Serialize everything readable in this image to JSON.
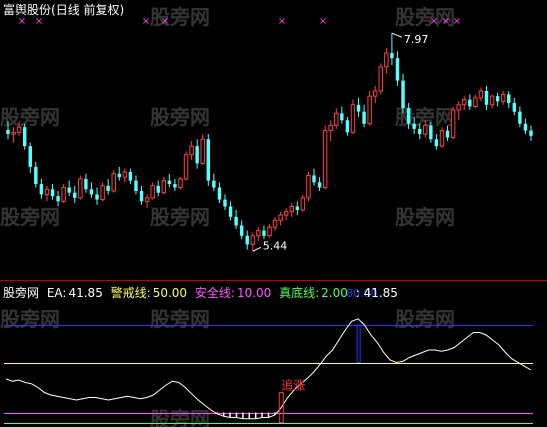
{
  "colors": {
    "background": "#000000",
    "up_candle": "#ff4040",
    "down_candle": "#54ffff",
    "top_marker": "#ff40ff",
    "panel_divider": "#c00000",
    "indicator_line": "#ffffff",
    "warning_line": "#ffff54",
    "safety_line": "#ff54ff",
    "bottom_line": "#54ff54",
    "upper_line": "#3030ff",
    "signal": "#ff3030"
  },
  "header": {
    "stock_name": "富舆股份",
    "chart_mode": "(日线 前复权)"
  },
  "price_panel": {
    "high_label": "7.97",
    "low_label": "5.44",
    "markers": [
      "×",
      "×",
      "×",
      "×",
      "×",
      "×",
      "×",
      "×",
      "×"
    ]
  },
  "indicator": {
    "name": "股旁网",
    "ea_label": "EA:",
    "ea_value": "41.85",
    "warning_label": "警戒线:",
    "warning_value": "50.00",
    "safety_label": "安全线:",
    "safety_value": "10.00",
    "bottom_label": "真底线:",
    "bottom_value": "2.00",
    "extra_value": ": 41.85",
    "upper_value": "80.00",
    "signal_label": "追涨"
  },
  "watermarks": [
    "股旁网",
    "股旁网",
    "股旁网",
    "股旁网",
    "股旁网",
    "股旁网",
    "股旁网",
    "股旁网",
    "股旁网",
    "股旁网",
    "股旁网",
    "股旁网"
  ],
  "chart_data": [
    {
      "type": "candlestick",
      "title": "",
      "ylim": [
        5.2,
        8.1
      ],
      "candles": [
        {
          "o": 6.85,
          "h": 6.95,
          "l": 6.74,
          "c": 6.8
        },
        {
          "o": 6.8,
          "h": 6.88,
          "l": 6.7,
          "c": 6.82
        },
        {
          "o": 6.82,
          "h": 6.95,
          "l": 6.78,
          "c": 6.88
        },
        {
          "o": 6.88,
          "h": 6.92,
          "l": 6.62,
          "c": 6.66
        },
        {
          "o": 6.66,
          "h": 6.7,
          "l": 6.35,
          "c": 6.42
        },
        {
          "o": 6.42,
          "h": 6.48,
          "l": 6.18,
          "c": 6.22
        },
        {
          "o": 6.22,
          "h": 6.28,
          "l": 6.05,
          "c": 6.1
        },
        {
          "o": 6.1,
          "h": 6.2,
          "l": 6.02,
          "c": 6.16
        },
        {
          "o": 6.16,
          "h": 6.22,
          "l": 6.04,
          "c": 6.08
        },
        {
          "o": 6.08,
          "h": 6.14,
          "l": 5.96,
          "c": 6.02
        },
        {
          "o": 6.02,
          "h": 6.22,
          "l": 6.0,
          "c": 6.18
        },
        {
          "o": 6.18,
          "h": 6.26,
          "l": 6.08,
          "c": 6.12
        },
        {
          "o": 6.12,
          "h": 6.2,
          "l": 6.0,
          "c": 6.06
        },
        {
          "o": 6.06,
          "h": 6.32,
          "l": 6.04,
          "c": 6.28
        },
        {
          "o": 6.28,
          "h": 6.34,
          "l": 6.12,
          "c": 6.16
        },
        {
          "o": 6.16,
          "h": 6.24,
          "l": 6.06,
          "c": 6.1
        },
        {
          "o": 6.1,
          "h": 6.18,
          "l": 5.98,
          "c": 6.04
        },
        {
          "o": 6.04,
          "h": 6.24,
          "l": 6.02,
          "c": 6.2
        },
        {
          "o": 6.2,
          "h": 6.28,
          "l": 6.1,
          "c": 6.14
        },
        {
          "o": 6.14,
          "h": 6.38,
          "l": 6.12,
          "c": 6.34
        },
        {
          "o": 6.34,
          "h": 6.42,
          "l": 6.26,
          "c": 6.3
        },
        {
          "o": 6.3,
          "h": 6.4,
          "l": 6.24,
          "c": 6.36
        },
        {
          "o": 6.36,
          "h": 6.4,
          "l": 6.22,
          "c": 6.26
        },
        {
          "o": 6.26,
          "h": 6.32,
          "l": 6.1,
          "c": 6.14
        },
        {
          "o": 6.14,
          "h": 6.2,
          "l": 5.98,
          "c": 6.02
        },
        {
          "o": 6.02,
          "h": 6.1,
          "l": 5.94,
          "c": 6.06
        },
        {
          "o": 6.06,
          "h": 6.24,
          "l": 6.04,
          "c": 6.2
        },
        {
          "o": 6.2,
          "h": 6.26,
          "l": 6.08,
          "c": 6.12
        },
        {
          "o": 6.12,
          "h": 6.3,
          "l": 6.1,
          "c": 6.26
        },
        {
          "o": 6.26,
          "h": 6.34,
          "l": 6.18,
          "c": 6.22
        },
        {
          "o": 6.22,
          "h": 6.28,
          "l": 6.14,
          "c": 6.18
        },
        {
          "o": 6.18,
          "h": 6.3,
          "l": 6.16,
          "c": 6.28
        },
        {
          "o": 6.28,
          "h": 6.6,
          "l": 6.26,
          "c": 6.56
        },
        {
          "o": 6.56,
          "h": 6.72,
          "l": 6.5,
          "c": 6.66
        },
        {
          "o": 6.66,
          "h": 6.74,
          "l": 6.4,
          "c": 6.46
        },
        {
          "o": 6.46,
          "h": 6.8,
          "l": 6.44,
          "c": 6.74
        },
        {
          "o": 6.74,
          "h": 6.8,
          "l": 6.2,
          "c": 6.26
        },
        {
          "o": 6.26,
          "h": 6.34,
          "l": 6.14,
          "c": 6.18
        },
        {
          "o": 6.18,
          "h": 6.24,
          "l": 6.0,
          "c": 6.04
        },
        {
          "o": 6.04,
          "h": 6.1,
          "l": 5.92,
          "c": 5.96
        },
        {
          "o": 5.96,
          "h": 6.02,
          "l": 5.8,
          "c": 5.84
        },
        {
          "o": 5.84,
          "h": 5.92,
          "l": 5.7,
          "c": 5.74
        },
        {
          "o": 5.74,
          "h": 5.8,
          "l": 5.58,
          "c": 5.62
        },
        {
          "o": 5.62,
          "h": 5.68,
          "l": 5.46,
          "c": 5.52
        },
        {
          "o": 5.52,
          "h": 5.66,
          "l": 5.44,
          "c": 5.62
        },
        {
          "o": 5.62,
          "h": 5.72,
          "l": 5.56,
          "c": 5.68
        },
        {
          "o": 5.68,
          "h": 5.74,
          "l": 5.58,
          "c": 5.62
        },
        {
          "o": 5.62,
          "h": 5.76,
          "l": 5.6,
          "c": 5.72
        },
        {
          "o": 5.72,
          "h": 5.84,
          "l": 5.68,
          "c": 5.8
        },
        {
          "o": 5.8,
          "h": 5.9,
          "l": 5.74,
          "c": 5.86
        },
        {
          "o": 5.86,
          "h": 5.94,
          "l": 5.8,
          "c": 5.9
        },
        {
          "o": 5.9,
          "h": 6.0,
          "l": 5.84,
          "c": 5.96
        },
        {
          "o": 5.96,
          "h": 6.02,
          "l": 5.86,
          "c": 5.92
        },
        {
          "o": 5.92,
          "h": 6.1,
          "l": 5.9,
          "c": 6.06
        },
        {
          "o": 6.06,
          "h": 6.36,
          "l": 6.02,
          "c": 6.32
        },
        {
          "o": 6.32,
          "h": 6.4,
          "l": 6.2,
          "c": 6.24
        },
        {
          "o": 6.24,
          "h": 6.3,
          "l": 6.14,
          "c": 6.18
        },
        {
          "o": 6.18,
          "h": 6.9,
          "l": 6.16,
          "c": 6.84
        },
        {
          "o": 6.84,
          "h": 6.96,
          "l": 6.72,
          "c": 6.9
        },
        {
          "o": 6.9,
          "h": 7.1,
          "l": 6.86,
          "c": 7.04
        },
        {
          "o": 7.04,
          "h": 7.12,
          "l": 6.92,
          "c": 6.96
        },
        {
          "o": 6.96,
          "h": 7.0,
          "l": 6.78,
          "c": 6.82
        },
        {
          "o": 6.82,
          "h": 7.2,
          "l": 6.8,
          "c": 7.14
        },
        {
          "o": 7.14,
          "h": 7.22,
          "l": 7.0,
          "c": 7.06
        },
        {
          "o": 7.06,
          "h": 7.14,
          "l": 6.88,
          "c": 6.92
        },
        {
          "o": 6.92,
          "h": 7.3,
          "l": 6.9,
          "c": 7.24
        },
        {
          "o": 7.24,
          "h": 7.36,
          "l": 7.16,
          "c": 7.3
        },
        {
          "o": 7.3,
          "h": 7.62,
          "l": 7.26,
          "c": 7.58
        },
        {
          "o": 7.58,
          "h": 7.8,
          "l": 7.5,
          "c": 7.74
        },
        {
          "o": 7.74,
          "h": 7.97,
          "l": 7.6,
          "c": 7.68
        },
        {
          "o": 7.68,
          "h": 7.76,
          "l": 7.36,
          "c": 7.42
        },
        {
          "o": 7.42,
          "h": 7.5,
          "l": 7.04,
          "c": 7.1
        },
        {
          "o": 7.1,
          "h": 7.16,
          "l": 6.86,
          "c": 6.92
        },
        {
          "o": 6.92,
          "h": 7.0,
          "l": 6.8,
          "c": 6.86
        },
        {
          "o": 6.86,
          "h": 6.92,
          "l": 6.74,
          "c": 6.8
        },
        {
          "o": 6.8,
          "h": 6.96,
          "l": 6.76,
          "c": 6.9
        },
        {
          "o": 6.9,
          "h": 6.94,
          "l": 6.7,
          "c": 6.74
        },
        {
          "o": 6.74,
          "h": 6.8,
          "l": 6.62,
          "c": 6.66
        },
        {
          "o": 6.66,
          "h": 6.88,
          "l": 6.64,
          "c": 6.84
        },
        {
          "o": 6.84,
          "h": 6.9,
          "l": 6.72,
          "c": 6.76
        },
        {
          "o": 6.76,
          "h": 7.12,
          "l": 6.74,
          "c": 7.08
        },
        {
          "o": 7.08,
          "h": 7.18,
          "l": 6.96,
          "c": 7.14
        },
        {
          "o": 7.14,
          "h": 7.24,
          "l": 7.08,
          "c": 7.2
        },
        {
          "o": 7.2,
          "h": 7.26,
          "l": 7.08,
          "c": 7.12
        },
        {
          "o": 7.12,
          "h": 7.26,
          "l": 7.1,
          "c": 7.22
        },
        {
          "o": 7.22,
          "h": 7.34,
          "l": 7.18,
          "c": 7.3
        },
        {
          "o": 7.3,
          "h": 7.36,
          "l": 7.08,
          "c": 7.14
        },
        {
          "o": 7.14,
          "h": 7.26,
          "l": 7.1,
          "c": 7.24
        },
        {
          "o": 7.24,
          "h": 7.28,
          "l": 7.12,
          "c": 7.18
        },
        {
          "o": 7.18,
          "h": 7.3,
          "l": 7.14,
          "c": 7.26
        },
        {
          "o": 7.26,
          "h": 7.3,
          "l": 7.1,
          "c": 7.16
        },
        {
          "o": 7.16,
          "h": 7.22,
          "l": 7.02,
          "c": 7.06
        },
        {
          "o": 7.06,
          "h": 7.12,
          "l": 6.88,
          "c": 6.92
        },
        {
          "o": 6.92,
          "h": 6.98,
          "l": 6.8,
          "c": 6.84
        },
        {
          "o": 6.84,
          "h": 6.9,
          "l": 6.72,
          "c": 6.78
        }
      ]
    },
    {
      "type": "line",
      "ylim": [
        0,
        100
      ],
      "reference_lines": {
        "upper": 80,
        "warning": 50,
        "safety": 10,
        "bottom": 2
      },
      "series": [
        {
          "name": "EA",
          "values": [
            37,
            35,
            36,
            34,
            33,
            30,
            26,
            24,
            23,
            22,
            21,
            20,
            21,
            22,
            22,
            21,
            20,
            21,
            22,
            23,
            22,
            21,
            22,
            24,
            28,
            32,
            35,
            34,
            30,
            25,
            20,
            16,
            12,
            9,
            7,
            6,
            6,
            5,
            5,
            5,
            6,
            6,
            8,
            14,
            22,
            28,
            33,
            37,
            42,
            48,
            55,
            60,
            68,
            76,
            83,
            85,
            80,
            72,
            66,
            58,
            52,
            50,
            51,
            54,
            56,
            58,
            60,
            60,
            59,
            60,
            62,
            66,
            70,
            74,
            74,
            72,
            68,
            64,
            58,
            53,
            50,
            47,
            44
          ]
        }
      ]
    }
  ]
}
